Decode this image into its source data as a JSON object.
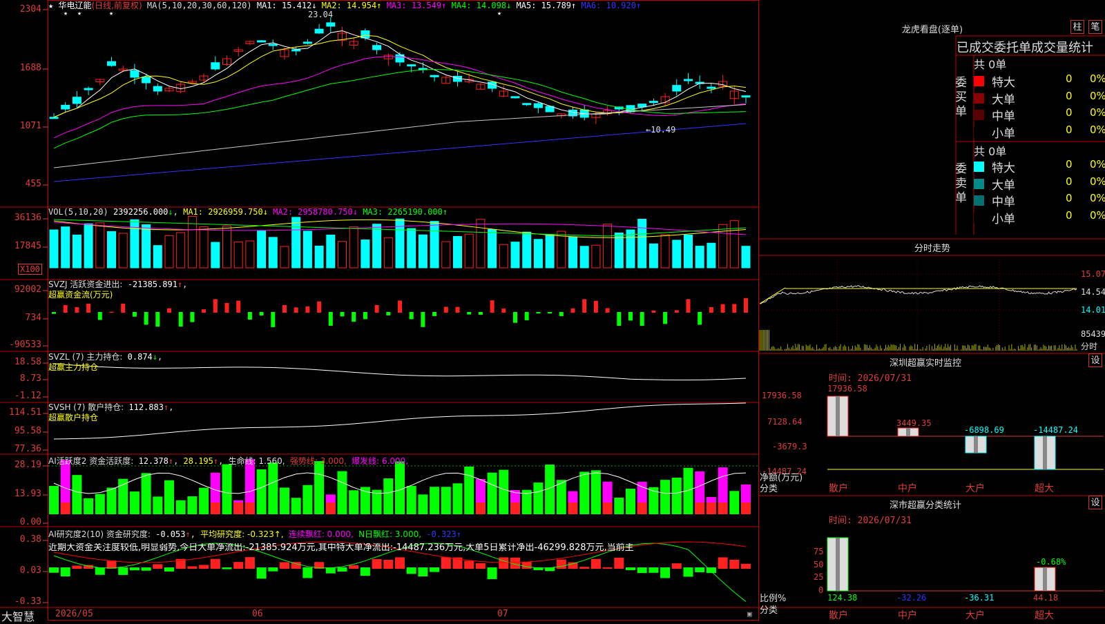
{
  "stock": {
    "name": "华电辽能",
    "period_label": "(日线,前复权)",
    "star_marks": "★"
  },
  "kline": {
    "ma_label": "MA(5,10,20,30,60,120)",
    "ma_values": [
      {
        "label": "MA1:",
        "value": "15.412",
        "arrow": "↓",
        "color": "#ffffff"
      },
      {
        "label": "MA2:",
        "value": "14.954",
        "arrow": "↑",
        "color": "#ffff00"
      },
      {
        "label": "MA3:",
        "value": "13.549",
        "arrow": "↑",
        "color": "#ff00ff"
      },
      {
        "label": "MA4:",
        "value": "14.098",
        "arrow": "↓",
        "color": "#00ff00"
      },
      {
        "label": "MA5:",
        "value": "15.789",
        "arrow": "↑",
        "color": "#ffffff"
      },
      {
        "label": "MA6:",
        "value": "10.920",
        "arrow": "↑",
        "color": "#3333ff"
      }
    ],
    "y_ticks": [
      "2304",
      "1688",
      "1071",
      "455"
    ],
    "high_marker": "23.04",
    "low_marker": "←10.49"
  },
  "vol": {
    "label": "VOL(5,10,20)",
    "value": "2392256.000",
    "arrow": "↓",
    "mas": [
      {
        "label": "MA1:",
        "value": "2926959.750",
        "arrow": "↓",
        "color": "#ffff00"
      },
      {
        "label": "MA2:",
        "value": "2958780.750",
        "arrow": "↓",
        "color": "#ff00ff"
      },
      {
        "label": "MA3:",
        "value": "2265190.000",
        "arrow": "↑",
        "color": "#00ff00"
      }
    ],
    "y_ticks": [
      "36136",
      "17845"
    ],
    "unit": "X100"
  },
  "svzj": {
    "label": "SVZJ  活跃资金进出:",
    "value": "-21385.891",
    "arrow": "↑",
    "sub": "超赢资金流(万元)",
    "y_ticks": [
      "92002",
      "734",
      "-90533"
    ]
  },
  "svzl": {
    "label": "SVZL (7) 主力持仓:",
    "value": "0.874",
    "arrow": "↓",
    "sub": "超赢主力持仓",
    "y_ticks": [
      "18.58",
      "8.73",
      "-1.12"
    ]
  },
  "svsh": {
    "label": "SVSH (7) 散户持仓:",
    "value": "112.883",
    "arrow": "↑",
    "sub": "超赢散户持仓",
    "y_ticks": [
      "114.51",
      "95.58",
      "77.36"
    ]
  },
  "ai_active": {
    "label": "AI活跃度2 资金活跃度:",
    "value": "12.378",
    "arrow": "↑",
    "v2": "28.195",
    "life": "生命线: 1.560,",
    "strong": "强势线: 3.000,",
    "burst": "爆发线: 6.000,",
    "y_ticks": [
      "28.19",
      "13.93",
      "0.00"
    ]
  },
  "ai_research": {
    "label": "AI研究度2(10) 资金研究度:",
    "value": "-0.053",
    "arrow": "↑",
    "avg": "平均研究度: -0.323↑,",
    "red": "连续飘红: 0.000,",
    "nred": "N日飘红: 3.000,",
    "last": "-0.323↑",
    "summary": "近期大资金关注度较低,明显弱势,今日大单净流出:-21385.924万元,其中特大单净流出:-14487.236万元,大单5日累计净出-46299.828万元,当前主",
    "y_ticks": [
      "0.38",
      "0.03",
      "-0.33"
    ]
  },
  "x_axis": {
    "brand": "大智慧",
    "labels": [
      "2026/05",
      "06",
      "07"
    ]
  },
  "lhb": {
    "title": "龙虎看盘(逐单)",
    "btn1": "柱",
    "btn2": "笔",
    "subtitle": "已成交委托单成交量统计",
    "buy": {
      "label": "委买单",
      "total": "共 0单",
      "rows": [
        {
          "name": "特大",
          "n": "0",
          "p": "0%",
          "color": "#ff0000"
        },
        {
          "name": "大单",
          "n": "0",
          "p": "0%",
          "color": "#8b0000"
        },
        {
          "name": "中单",
          "n": "0",
          "p": "0%",
          "color": "#5a0000"
        },
        {
          "name": "小单",
          "n": "0",
          "p": "0%",
          "color": "#000000"
        }
      ]
    },
    "sell": {
      "label": "委卖单",
      "total": "共 0单",
      "rows": [
        {
          "name": "特大",
          "n": "0",
          "p": "0%",
          "color": "#00ffff"
        },
        {
          "name": "大单",
          "n": "0",
          "p": "0%",
          "color": "#008b8b"
        },
        {
          "name": "中单",
          "n": "0",
          "p": "0%",
          "color": "#007070"
        },
        {
          "name": "小单",
          "n": "0",
          "p": "0%",
          "color": "#000000"
        }
      ]
    }
  },
  "intraday": {
    "title": "分时走势",
    "prices": [
      "15.07",
      "14.54",
      "14.01"
    ],
    "vol": "85439",
    "vol_unit": "分时"
  },
  "monitor": {
    "title": "深圳超赢实时监控",
    "btn": "设",
    "time": "时间: 2026/07/31",
    "y_ticks": [
      "17936.58",
      "7128.64",
      "-3679.3",
      "-14487.24"
    ],
    "unit_label": "净额(万元)",
    "cat_label": "分类",
    "bars": [
      {
        "cat": "散户",
        "value": "17936.58"
      },
      {
        "cat": "中户",
        "value": "3449.35"
      },
      {
        "cat": "大户",
        "value": "-6898.69"
      },
      {
        "cat": "超大",
        "value": "-14487.24"
      }
    ]
  },
  "classify": {
    "title": "深市超赢分类统计",
    "btn": "设",
    "time": "时间: 2026/07/31",
    "y_ticks": [
      "75",
      "50",
      "25",
      "0"
    ],
    "pct_label": "比例%",
    "cat_label": "分类",
    "bars": [
      {
        "cat": "散户",
        "value": "124.38"
      },
      {
        "cat": "中户",
        "value": "-32.26"
      },
      {
        "cat": "大户",
        "value": "-36.31"
      },
      {
        "cat": "超大",
        "value": "44.18"
      }
    ],
    "top_label": "-0.68%"
  },
  "colors": {
    "up": "#ff2020",
    "down": "#00ffff",
    "grid": "#8b0000",
    "label": "#e03c3c",
    "cyan": "#00ffff",
    "bar_green": "#00ff00",
    "magenta": "#ff00ff"
  }
}
